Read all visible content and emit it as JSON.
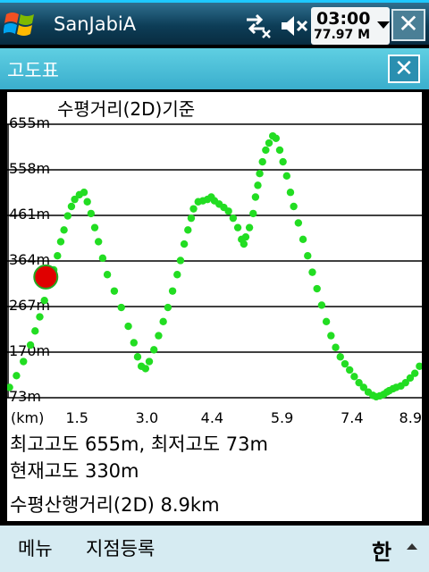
{
  "taskbar": {
    "app_title": "SanJabiA",
    "clock_time": "03:00",
    "clock_speed": "77.97 M",
    "accent": "#1ec8ff"
  },
  "dialog": {
    "title": "고도표",
    "close_glyph": "✕"
  },
  "chart_data": {
    "type": "scatter",
    "title": "수평거리(2D)기준",
    "xlabel": "(km)",
    "ylabel": "",
    "x_ticks": [
      "1.5",
      "3.0",
      "4.4",
      "5.9",
      "7.4",
      "8.9"
    ],
    "y_ticks": [
      "73m",
      "170m",
      "267m",
      "364m",
      "461m",
      "558m",
      "655m"
    ],
    "xlim": [
      0,
      8.9
    ],
    "ylim": [
      73,
      655
    ],
    "grid": true,
    "point_color": "#22dd22",
    "marker_color": "#e00000",
    "current_position": {
      "x": 0.83,
      "y": 330
    },
    "series": [
      {
        "points": [
          [
            0.05,
            95
          ],
          [
            0.2,
            120
          ],
          [
            0.35,
            150
          ],
          [
            0.5,
            185
          ],
          [
            0.6,
            215
          ],
          [
            0.7,
            245
          ],
          [
            0.8,
            280
          ],
          [
            0.9,
            315
          ],
          [
            1.0,
            345
          ],
          [
            1.08,
            375
          ],
          [
            1.15,
            405
          ],
          [
            1.22,
            430
          ],
          [
            1.3,
            460
          ],
          [
            1.38,
            480
          ],
          [
            1.45,
            495
          ],
          [
            1.55,
            505
          ],
          [
            1.65,
            510
          ],
          [
            1.72,
            490
          ],
          [
            1.8,
            465
          ],
          [
            1.88,
            435
          ],
          [
            1.96,
            405
          ],
          [
            2.05,
            370
          ],
          [
            2.15,
            335
          ],
          [
            2.3,
            300
          ],
          [
            2.45,
            265
          ],
          [
            2.6,
            225
          ],
          [
            2.72,
            190
          ],
          [
            2.8,
            160
          ],
          [
            2.88,
            140
          ],
          [
            2.97,
            135
          ],
          [
            3.05,
            150
          ],
          [
            3.15,
            175
          ],
          [
            3.25,
            205
          ],
          [
            3.35,
            235
          ],
          [
            3.45,
            265
          ],
          [
            3.55,
            300
          ],
          [
            3.65,
            335
          ],
          [
            3.72,
            365
          ],
          [
            3.8,
            400
          ],
          [
            3.88,
            430
          ],
          [
            3.95,
            455
          ],
          [
            4.0,
            475
          ],
          [
            4.1,
            490
          ],
          [
            4.2,
            492
          ],
          [
            4.3,
            495
          ],
          [
            4.38,
            500
          ],
          [
            4.45,
            492
          ],
          [
            4.55,
            485
          ],
          [
            4.65,
            478
          ],
          [
            4.75,
            470
          ],
          [
            4.85,
            455
          ],
          [
            4.95,
            435
          ],
          [
            5.03,
            410
          ],
          [
            5.08,
            400
          ],
          [
            5.12,
            415
          ],
          [
            5.2,
            435
          ],
          [
            5.28,
            465
          ],
          [
            5.33,
            500
          ],
          [
            5.38,
            525
          ],
          [
            5.42,
            550
          ],
          [
            5.48,
            575
          ],
          [
            5.55,
            600
          ],
          [
            5.62,
            615
          ],
          [
            5.7,
            630
          ],
          [
            5.77,
            625
          ],
          [
            5.85,
            600
          ],
          [
            5.92,
            575
          ],
          [
            6.0,
            545
          ],
          [
            6.08,
            510
          ],
          [
            6.15,
            480
          ],
          [
            6.25,
            445
          ],
          [
            6.35,
            410
          ],
          [
            6.45,
            375
          ],
          [
            6.55,
            340
          ],
          [
            6.65,
            305
          ],
          [
            6.75,
            270
          ],
          [
            6.85,
            235
          ],
          [
            6.95,
            205
          ],
          [
            7.05,
            180
          ],
          [
            7.15,
            160
          ],
          [
            7.25,
            145
          ],
          [
            7.35,
            132
          ],
          [
            7.45,
            118
          ],
          [
            7.55,
            105
          ],
          [
            7.65,
            95
          ],
          [
            7.75,
            85
          ],
          [
            7.85,
            78
          ],
          [
            7.92,
            75
          ],
          [
            8.0,
            77
          ],
          [
            8.08,
            80
          ],
          [
            8.15,
            85
          ],
          [
            8.2,
            88
          ],
          [
            8.28,
            92
          ],
          [
            8.35,
            95
          ],
          [
            8.45,
            98
          ],
          [
            8.55,
            105
          ],
          [
            8.65,
            115
          ],
          [
            8.75,
            125
          ],
          [
            8.85,
            140
          ]
        ]
      }
    ]
  },
  "stats": {
    "line1": "최고고도 655m, 최저고도 73m",
    "line2": "현재고도 330m",
    "line3": "수평산행거리(2D)  8.9km"
  },
  "menu": {
    "left": "메뉴",
    "right": "지점등록",
    "ime_glyph": "한"
  }
}
